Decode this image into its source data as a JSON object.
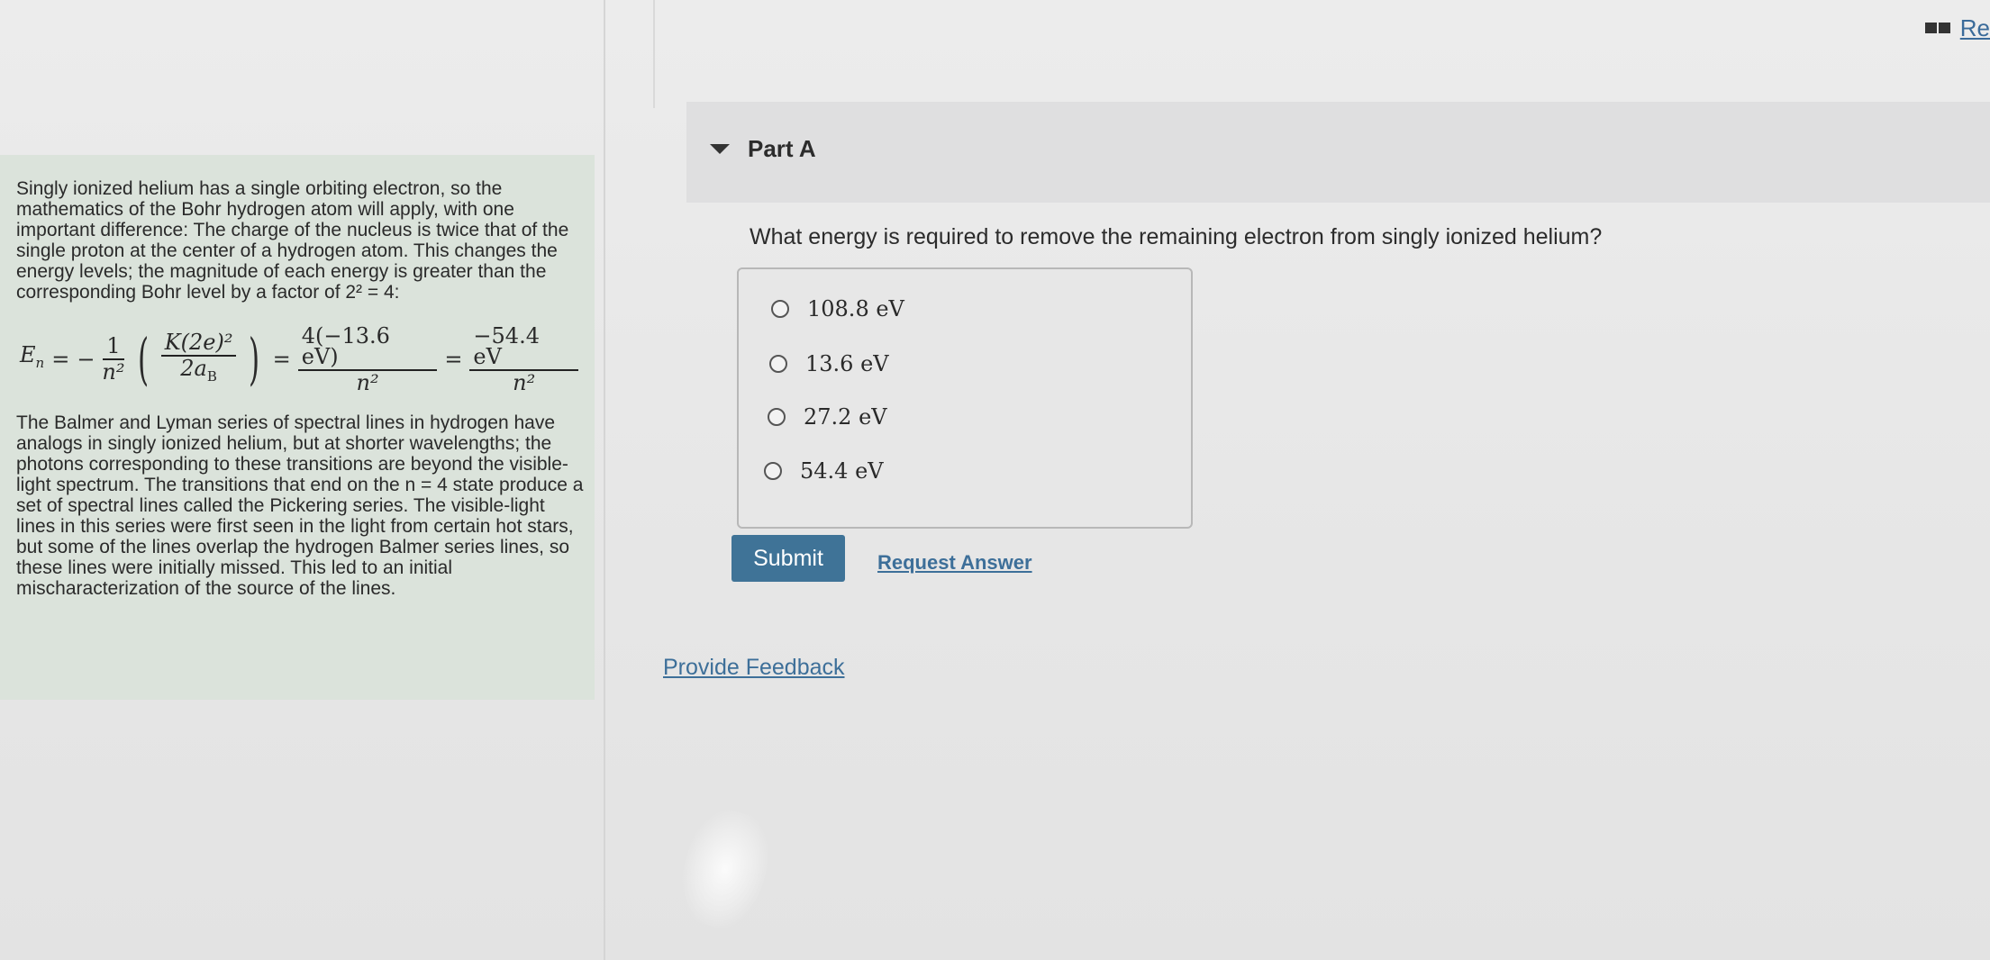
{
  "toolbar": {
    "reading_label": "Re",
    "icons": {
      "reading": "book-icon"
    }
  },
  "context": {
    "intro_text": "Singly ionized helium has a single orbiting electron, so the mathematics of the Bohr hydrogen atom will apply, with one important difference: The charge of the nucleus is twice that of the single proton at the center of a hydrogen atom. This changes the energy levels; the magnitude of each energy is greater than the corresponding Bohr level by a factor of 2² = 4:",
    "equation": {
      "lhs": "E",
      "lhs_sub": "n",
      "equals": "=",
      "minus": "−",
      "frac1_num": "1",
      "frac1_den": "n²",
      "frac2_num": "K(2e)²",
      "frac2_den": "2a",
      "frac2_den_sub": "B",
      "frac3_num": "4(−13.6 eV)",
      "frac3_den": "n²",
      "frac4_num": "−54.4 eV",
      "frac4_den": "n²"
    },
    "body_text": "The Balmer and Lyman series of spectral lines in hydrogen have analogs in singly ionized helium, but at shorter wavelengths; the photons corresponding to these transitions are beyond the visible-light spectrum. The transitions that end on the n = 4 state produce a set of spectral lines called the Pickering series. The visible-light lines in this series were first seen in the light from certain hot stars, but some of the lines overlap the hydrogen Balmer series lines, so these lines were initially missed. This led to an initial mischaracterization of the source of the lines."
  },
  "part": {
    "title": "Part A",
    "question": "What energy is required to remove the remaining electron from singly ionized helium?",
    "options": [
      {
        "label": "108.8 eV",
        "selected": false
      },
      {
        "label": "13.6 eV",
        "selected": false
      },
      {
        "label": "27.2 eV",
        "selected": false
      },
      {
        "label": "54.4 eV",
        "selected": false
      }
    ],
    "submit_label": "Submit",
    "request_answer_label": "Request Answer"
  },
  "footer": {
    "feedback_label": "Provide Feedback"
  },
  "colors": {
    "accent_button": "#3f7397",
    "link": "#3d6f99",
    "context_bg": "#dbe3db"
  }
}
